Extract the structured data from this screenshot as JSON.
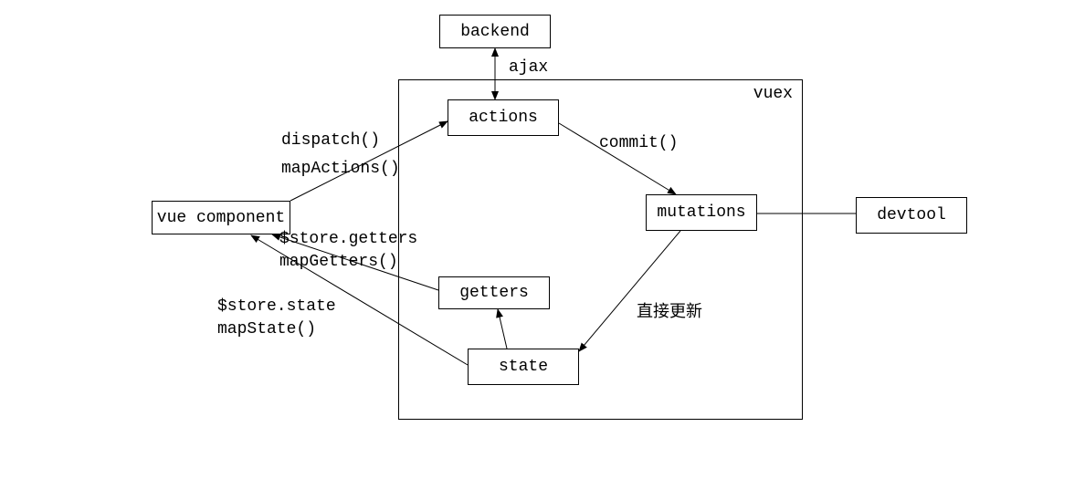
{
  "nodes": {
    "backend": "backend",
    "actions": "actions",
    "mutations": "mutations",
    "getters": "getters",
    "state": "state",
    "vueComponent": "vue component",
    "devtool": "devtool"
  },
  "container": {
    "label": "vuex"
  },
  "edges": {
    "ajax": "ajax",
    "dispatch": "dispatch()",
    "mapActions": "mapActions()",
    "commit": "commit()",
    "directUpdate": "直接更新",
    "storeGetters": "$store.getters",
    "mapGetters": "mapGetters()",
    "storeState": "$store.state",
    "mapState": "mapState()"
  }
}
